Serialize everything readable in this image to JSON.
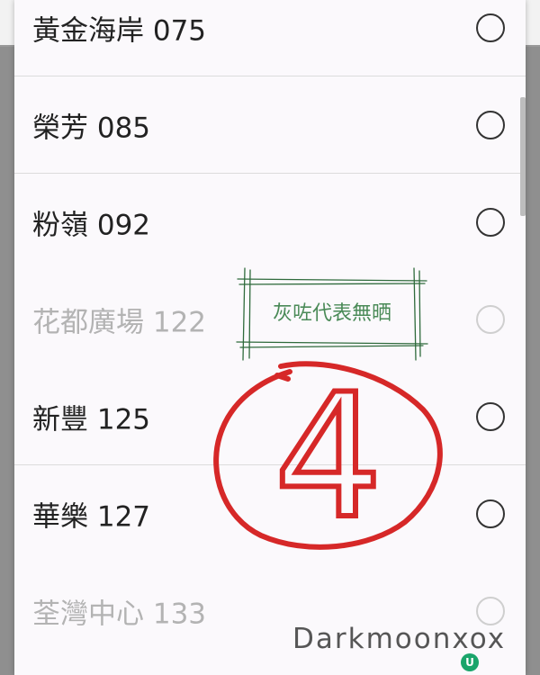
{
  "options": [
    {
      "label": "黃金海岸 075",
      "enabled": true
    },
    {
      "label": "榮芳 085",
      "enabled": true
    },
    {
      "label": "粉嶺 092",
      "enabled": true
    },
    {
      "label": "花都廣場 122",
      "enabled": false
    },
    {
      "label": "新豐 125",
      "enabled": true
    },
    {
      "label": "華樂 127",
      "enabled": true
    },
    {
      "label": "荃灣中心 133",
      "enabled": false
    }
  ],
  "annotation": {
    "note": "灰咗代表無晒",
    "circled_number": "4",
    "note_color": "#4a8a57",
    "circle_color": "#d62828"
  },
  "watermark": {
    "text": "Darkmoonxox"
  }
}
